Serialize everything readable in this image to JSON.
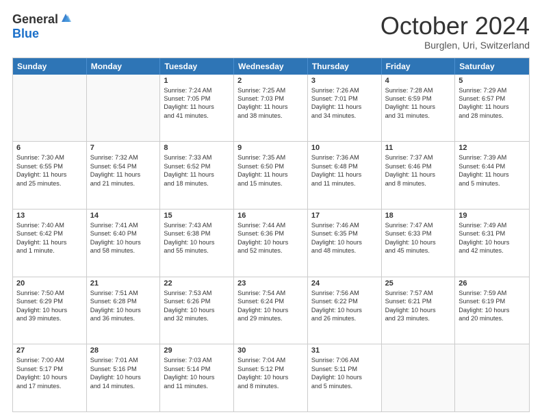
{
  "logo": {
    "general": "General",
    "blue": "Blue"
  },
  "header": {
    "title": "October 2024",
    "subtitle": "Burglen, Uri, Switzerland"
  },
  "days": [
    "Sunday",
    "Monday",
    "Tuesday",
    "Wednesday",
    "Thursday",
    "Friday",
    "Saturday"
  ],
  "weeks": [
    [
      {
        "day": "",
        "lines": []
      },
      {
        "day": "",
        "lines": []
      },
      {
        "day": "1",
        "lines": [
          "Sunrise: 7:24 AM",
          "Sunset: 7:05 PM",
          "Daylight: 11 hours",
          "and 41 minutes."
        ]
      },
      {
        "day": "2",
        "lines": [
          "Sunrise: 7:25 AM",
          "Sunset: 7:03 PM",
          "Daylight: 11 hours",
          "and 38 minutes."
        ]
      },
      {
        "day": "3",
        "lines": [
          "Sunrise: 7:26 AM",
          "Sunset: 7:01 PM",
          "Daylight: 11 hours",
          "and 34 minutes."
        ]
      },
      {
        "day": "4",
        "lines": [
          "Sunrise: 7:28 AM",
          "Sunset: 6:59 PM",
          "Daylight: 11 hours",
          "and 31 minutes."
        ]
      },
      {
        "day": "5",
        "lines": [
          "Sunrise: 7:29 AM",
          "Sunset: 6:57 PM",
          "Daylight: 11 hours",
          "and 28 minutes."
        ]
      }
    ],
    [
      {
        "day": "6",
        "lines": [
          "Sunrise: 7:30 AM",
          "Sunset: 6:55 PM",
          "Daylight: 11 hours",
          "and 25 minutes."
        ]
      },
      {
        "day": "7",
        "lines": [
          "Sunrise: 7:32 AM",
          "Sunset: 6:54 PM",
          "Daylight: 11 hours",
          "and 21 minutes."
        ]
      },
      {
        "day": "8",
        "lines": [
          "Sunrise: 7:33 AM",
          "Sunset: 6:52 PM",
          "Daylight: 11 hours",
          "and 18 minutes."
        ]
      },
      {
        "day": "9",
        "lines": [
          "Sunrise: 7:35 AM",
          "Sunset: 6:50 PM",
          "Daylight: 11 hours",
          "and 15 minutes."
        ]
      },
      {
        "day": "10",
        "lines": [
          "Sunrise: 7:36 AM",
          "Sunset: 6:48 PM",
          "Daylight: 11 hours",
          "and 11 minutes."
        ]
      },
      {
        "day": "11",
        "lines": [
          "Sunrise: 7:37 AM",
          "Sunset: 6:46 PM",
          "Daylight: 11 hours",
          "and 8 minutes."
        ]
      },
      {
        "day": "12",
        "lines": [
          "Sunrise: 7:39 AM",
          "Sunset: 6:44 PM",
          "Daylight: 11 hours",
          "and 5 minutes."
        ]
      }
    ],
    [
      {
        "day": "13",
        "lines": [
          "Sunrise: 7:40 AM",
          "Sunset: 6:42 PM",
          "Daylight: 11 hours",
          "and 1 minute."
        ]
      },
      {
        "day": "14",
        "lines": [
          "Sunrise: 7:41 AM",
          "Sunset: 6:40 PM",
          "Daylight: 10 hours",
          "and 58 minutes."
        ]
      },
      {
        "day": "15",
        "lines": [
          "Sunrise: 7:43 AM",
          "Sunset: 6:38 PM",
          "Daylight: 10 hours",
          "and 55 minutes."
        ]
      },
      {
        "day": "16",
        "lines": [
          "Sunrise: 7:44 AM",
          "Sunset: 6:36 PM",
          "Daylight: 10 hours",
          "and 52 minutes."
        ]
      },
      {
        "day": "17",
        "lines": [
          "Sunrise: 7:46 AM",
          "Sunset: 6:35 PM",
          "Daylight: 10 hours",
          "and 48 minutes."
        ]
      },
      {
        "day": "18",
        "lines": [
          "Sunrise: 7:47 AM",
          "Sunset: 6:33 PM",
          "Daylight: 10 hours",
          "and 45 minutes."
        ]
      },
      {
        "day": "19",
        "lines": [
          "Sunrise: 7:49 AM",
          "Sunset: 6:31 PM",
          "Daylight: 10 hours",
          "and 42 minutes."
        ]
      }
    ],
    [
      {
        "day": "20",
        "lines": [
          "Sunrise: 7:50 AM",
          "Sunset: 6:29 PM",
          "Daylight: 10 hours",
          "and 39 minutes."
        ]
      },
      {
        "day": "21",
        "lines": [
          "Sunrise: 7:51 AM",
          "Sunset: 6:28 PM",
          "Daylight: 10 hours",
          "and 36 minutes."
        ]
      },
      {
        "day": "22",
        "lines": [
          "Sunrise: 7:53 AM",
          "Sunset: 6:26 PM",
          "Daylight: 10 hours",
          "and 32 minutes."
        ]
      },
      {
        "day": "23",
        "lines": [
          "Sunrise: 7:54 AM",
          "Sunset: 6:24 PM",
          "Daylight: 10 hours",
          "and 29 minutes."
        ]
      },
      {
        "day": "24",
        "lines": [
          "Sunrise: 7:56 AM",
          "Sunset: 6:22 PM",
          "Daylight: 10 hours",
          "and 26 minutes."
        ]
      },
      {
        "day": "25",
        "lines": [
          "Sunrise: 7:57 AM",
          "Sunset: 6:21 PM",
          "Daylight: 10 hours",
          "and 23 minutes."
        ]
      },
      {
        "day": "26",
        "lines": [
          "Sunrise: 7:59 AM",
          "Sunset: 6:19 PM",
          "Daylight: 10 hours",
          "and 20 minutes."
        ]
      }
    ],
    [
      {
        "day": "27",
        "lines": [
          "Sunrise: 7:00 AM",
          "Sunset: 5:17 PM",
          "Daylight: 10 hours",
          "and 17 minutes."
        ]
      },
      {
        "day": "28",
        "lines": [
          "Sunrise: 7:01 AM",
          "Sunset: 5:16 PM",
          "Daylight: 10 hours",
          "and 14 minutes."
        ]
      },
      {
        "day": "29",
        "lines": [
          "Sunrise: 7:03 AM",
          "Sunset: 5:14 PM",
          "Daylight: 10 hours",
          "and 11 minutes."
        ]
      },
      {
        "day": "30",
        "lines": [
          "Sunrise: 7:04 AM",
          "Sunset: 5:12 PM",
          "Daylight: 10 hours",
          "and 8 minutes."
        ]
      },
      {
        "day": "31",
        "lines": [
          "Sunrise: 7:06 AM",
          "Sunset: 5:11 PM",
          "Daylight: 10 hours",
          "and 5 minutes."
        ]
      },
      {
        "day": "",
        "lines": []
      },
      {
        "day": "",
        "lines": []
      }
    ]
  ]
}
